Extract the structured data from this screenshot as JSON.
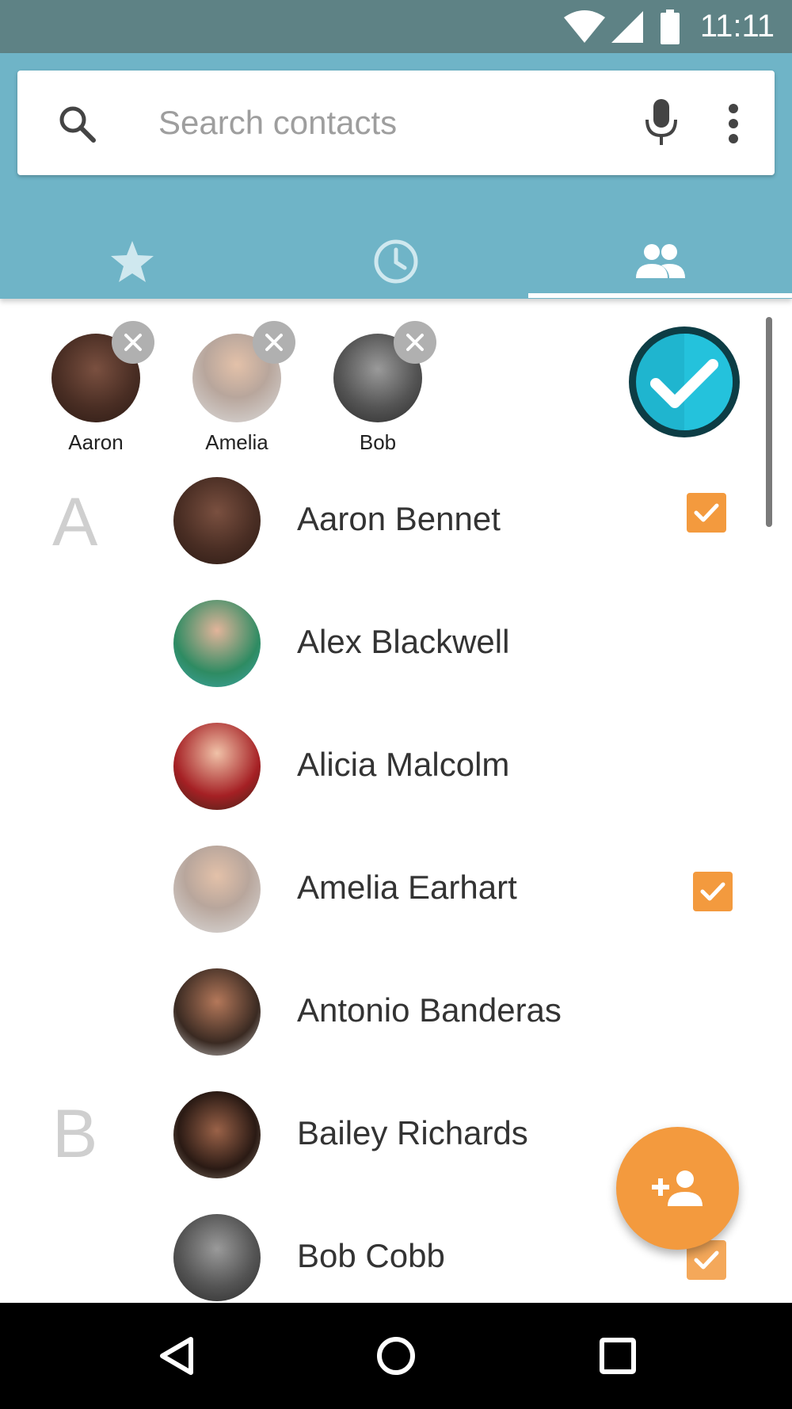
{
  "status_bar": {
    "time": "11:11"
  },
  "search": {
    "placeholder": "Search contacts"
  },
  "tabs": [
    {
      "id": "favorites",
      "icon": "star-icon"
    },
    {
      "id": "recents",
      "icon": "clock-icon"
    },
    {
      "id": "contacts",
      "icon": "people-icon",
      "selected": true
    }
  ],
  "selected_chips": [
    {
      "label": "Aaron"
    },
    {
      "label": "Amelia"
    },
    {
      "label": "Bob"
    }
  ],
  "sections": [
    "A",
    "B"
  ],
  "contacts": [
    {
      "name": "Aaron Bennet",
      "checked": true
    },
    {
      "name": "Alex Blackwell",
      "checked": false
    },
    {
      "name": "Alicia Malcolm",
      "checked": false
    },
    {
      "name": "Amelia Earhart",
      "checked": true
    },
    {
      "name": "Antonio Banderas",
      "checked": false
    },
    {
      "name": "Bailey Richards",
      "checked": false
    },
    {
      "name": "Bob Cobb",
      "checked": true
    }
  ],
  "colors": {
    "status_bar": "#5e8285",
    "app_bar": "#6fb4c7",
    "accent": "#f39a3e",
    "done_button": "#1fb5cf"
  }
}
